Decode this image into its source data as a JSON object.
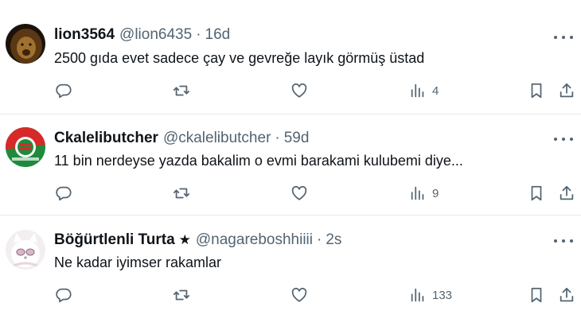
{
  "replies": [
    {
      "name": "lion3564",
      "handle": "@lion6435",
      "separator": "·",
      "time": "16d",
      "text": "2500 gıda evet sadece çay ve gevreğe layık görmüş üstad",
      "views": "4",
      "avatar_colors": [
        "#2b1a0c",
        "#8a5a22"
      ]
    },
    {
      "name": "Ckalelibutcher",
      "handle": "@ckalelibutcher",
      "separator": "·",
      "time": "59d",
      "text": "11 bin nerdeyse yazda bakalim o evmi barakami kulubemi diye...",
      "views": "9",
      "avatar_colors": [
        "#d62a2a",
        "#1f8a3c"
      ]
    },
    {
      "name": "Böğürtlenli Turta",
      "badge": "★",
      "handle": "@nagareboshhiiii",
      "separator": "·",
      "time": "2s",
      "text": "Ne kadar iyimser rakamlar",
      "views": "133",
      "avatar_colors": [
        "#f2eef0",
        "#c9a9b8"
      ]
    }
  ],
  "icons": {
    "reply": "reply-icon",
    "retweet": "retweet-icon",
    "like": "heart-icon",
    "views": "views-chart-icon",
    "bookmark": "bookmark-icon",
    "share": "share-icon",
    "more": "more-dots-icon"
  },
  "colors": {
    "text": "#0f1419",
    "secondary": "#536471",
    "divider": "#e6e9ec"
  }
}
